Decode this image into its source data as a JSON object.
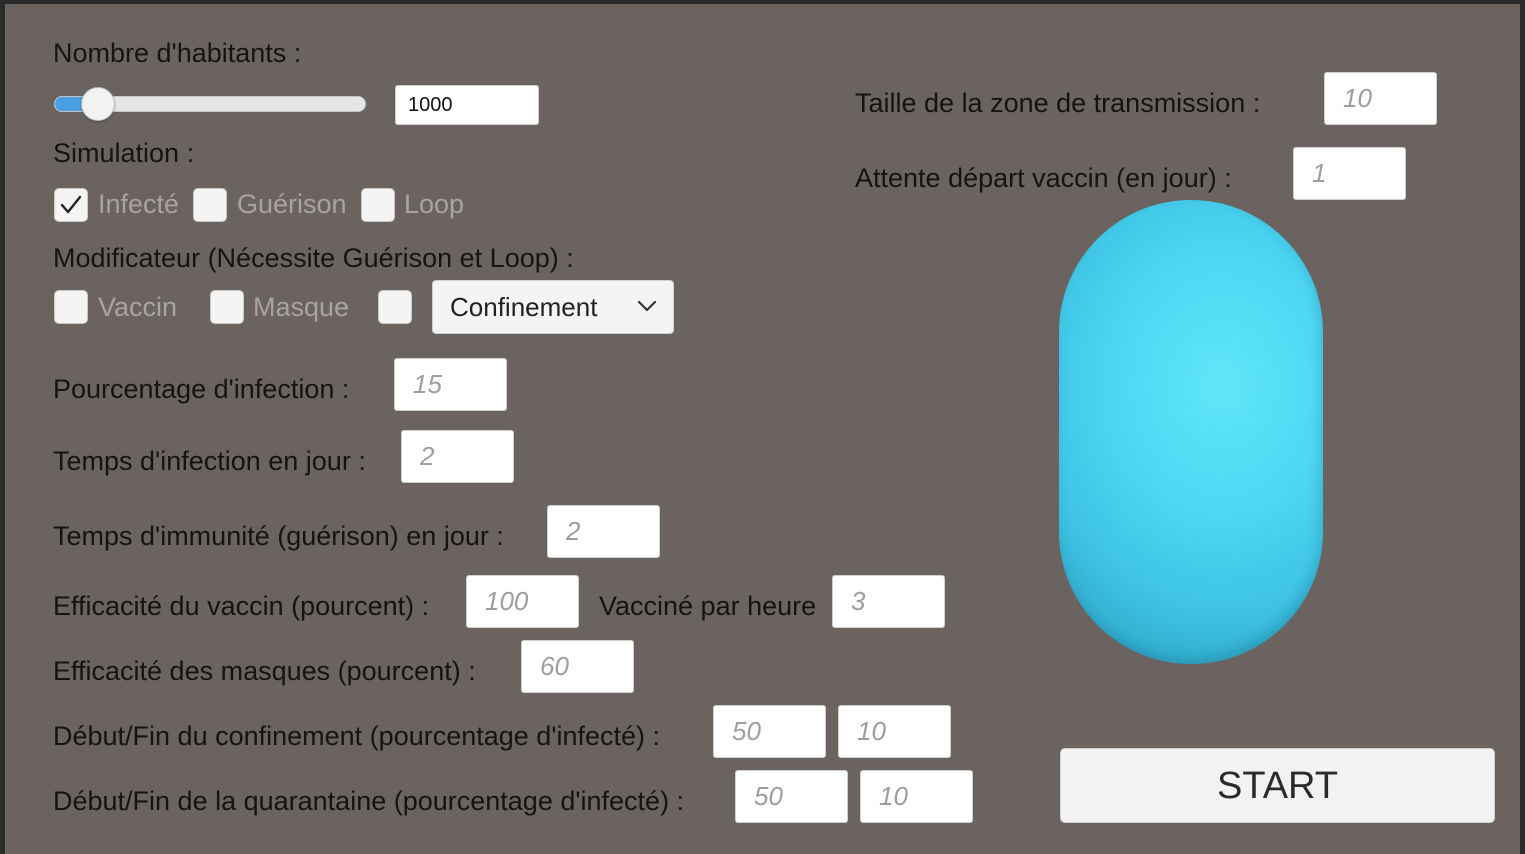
{
  "population": {
    "label": "Nombre d'habitants :",
    "value": "1000",
    "slider_fraction": 0.14
  },
  "simulation": {
    "label": "Simulation :",
    "options": [
      {
        "label": "Infecté",
        "checked": true
      },
      {
        "label": "Guérison",
        "checked": false
      },
      {
        "label": "Loop",
        "checked": false
      }
    ]
  },
  "modifiers": {
    "label": "Modificateur (Nécessite Guérison et Loop) :",
    "vaccine_label": "Vaccin",
    "mask_label": "Masque",
    "lockdown_option": "Confinement"
  },
  "fields": {
    "infection_pct": {
      "label": "Pourcentage d'infection :",
      "placeholder": "15"
    },
    "infection_time": {
      "label": "Temps d'infection en jour :",
      "placeholder": "2"
    },
    "immunity_time": {
      "label": "Temps d'immunité (guérison) en jour :",
      "placeholder": "2"
    },
    "vaccine_efficacy": {
      "label": "Efficacité du vaccin (pourcent) :",
      "placeholder": "100"
    },
    "vaccinated_per_hour": {
      "label": "Vacciné par heure",
      "placeholder": "3"
    },
    "mask_efficacy": {
      "label": "Efficacité des masques (pourcent) :",
      "placeholder": "60"
    },
    "lockdown_range": {
      "label": "Début/Fin du confinement (pourcentage d'infecté) :",
      "start_placeholder": "50",
      "end_placeholder": "10"
    },
    "quarantine_range": {
      "label": "Début/Fin de la quarantaine (pourcentage d'infecté) :",
      "start_placeholder": "50",
      "end_placeholder": "10"
    },
    "transmission_zone": {
      "label": "Taille de la zone de transmission :",
      "placeholder": "10"
    },
    "vaccine_delay": {
      "label": "Attente départ vaccin (en jour) :",
      "placeholder": "1"
    }
  },
  "start_button": {
    "label": "START"
  },
  "colors": {
    "panel_background": "#6b635f",
    "capsule": "#4fd8f3",
    "slider_fill": "#4b9ee0"
  },
  "icons": {
    "check": "checkmark-icon",
    "dropdown": "chevron-down-icon"
  }
}
